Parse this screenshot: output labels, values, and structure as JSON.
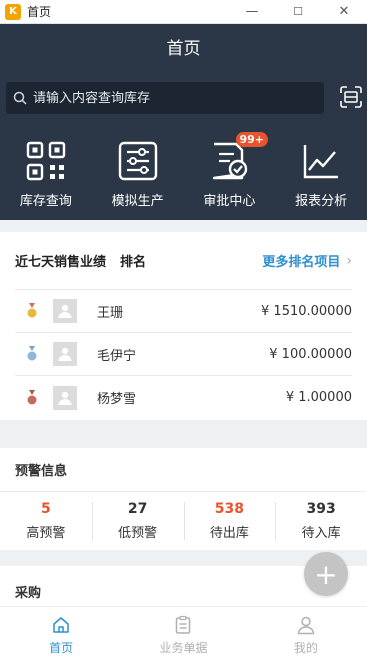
{
  "window": {
    "logo_text": "K",
    "title": "首页",
    "minimize": "—",
    "maximize": "☐",
    "close": "✕"
  },
  "header": {
    "title": "首页"
  },
  "search": {
    "placeholder": "请输入内容查询库存"
  },
  "menu": [
    {
      "label": "库存查询",
      "icon": "qr-grid-icon"
    },
    {
      "label": "模拟生产",
      "icon": "sliders-icon"
    },
    {
      "label": "审批中心",
      "icon": "approval-doc-icon",
      "badge": "99+"
    },
    {
      "label": "报表分析",
      "icon": "line-chart-icon"
    }
  ],
  "sales": {
    "title": "近七天销售业绩",
    "subtitle": "排名",
    "more": "更多排名项目",
    "rows": [
      {
        "name": "王珊",
        "amount": "¥ 1510.00000",
        "medal_color": "#e9b73a"
      },
      {
        "name": "毛伊宁",
        "amount": "¥ 100.00000",
        "medal_color": "#8fb6d8"
      },
      {
        "name": "杨梦雪",
        "amount": "¥ 1.00000",
        "medal_color": "#c46c5c"
      }
    ]
  },
  "warning": {
    "title": "预警信息",
    "items": [
      {
        "value": "5",
        "label": "高预警"
      },
      {
        "value": "27",
        "label": "低预警"
      },
      {
        "value": "538",
        "label": "待出库"
      },
      {
        "value": "393",
        "label": "待入库"
      }
    ]
  },
  "purchase": {
    "title": "采购"
  },
  "fab": {
    "label": "+"
  },
  "tabs": [
    {
      "label": "首页"
    },
    {
      "label": "业务单据"
    },
    {
      "label": "我的"
    }
  ],
  "colors": {
    "header_bg": "#2b3746",
    "accent": "#2e8fd0",
    "alert": "#e8542e"
  }
}
